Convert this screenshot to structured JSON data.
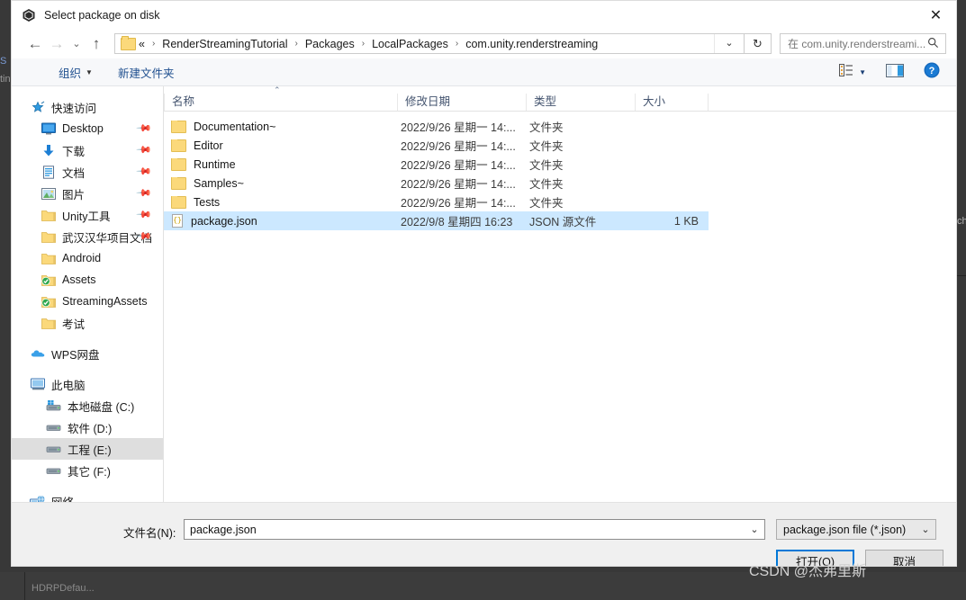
{
  "window": {
    "title": "Select package on disk",
    "app_icon": "unity-icon",
    "close_label": "✕"
  },
  "nav": {
    "back_icon": "←",
    "forward_icon": "→",
    "recent_icon": "⌄",
    "up_icon": "↑",
    "refresh_icon": "↻",
    "dropdown_icon": "⌄",
    "breadcrumbs": [
      "«",
      "RenderStreamingTutorial",
      "Packages",
      "LocalPackages",
      "com.unity.renderstreaming"
    ],
    "separator": "›"
  },
  "search": {
    "text": "在 com.unity.renderstreami...",
    "icon": "search-icon"
  },
  "command_bar": {
    "organize": "组织",
    "organize_chevron": "▼",
    "new_folder": "新建文件夹",
    "view_chevron": "▼",
    "help": "?"
  },
  "nav_pane": {
    "groups": [
      {
        "header": {
          "label": "快速访问",
          "icon": "star-pin-icon",
          "indent": 0,
          "pinned": false
        },
        "items": [
          {
            "label": "Desktop",
            "icon": "desktop-icon",
            "indent": 1,
            "pinned": true
          },
          {
            "label": "下载",
            "icon": "download-icon",
            "indent": 1,
            "pinned": true
          },
          {
            "label": "文档",
            "icon": "documents-icon",
            "indent": 1,
            "pinned": true
          },
          {
            "label": "图片",
            "icon": "pictures-icon",
            "indent": 1,
            "pinned": true
          },
          {
            "label": "Unity工具",
            "icon": "folder-icon",
            "indent": 1,
            "pinned": true
          },
          {
            "label": "武汉汉华项目文档",
            "icon": "folder-icon",
            "indent": 1,
            "pinned": true
          },
          {
            "label": "Android",
            "icon": "folder-icon",
            "indent": 1,
            "pinned": false
          },
          {
            "label": "Assets",
            "icon": "folder-sync-icon",
            "indent": 1,
            "pinned": false
          },
          {
            "label": "StreamingAssets",
            "icon": "folder-sync-icon",
            "indent": 1,
            "pinned": false
          },
          {
            "label": "考试",
            "icon": "folder-icon",
            "indent": 1,
            "pinned": false
          }
        ]
      },
      {
        "header": {
          "label": "WPS网盘",
          "icon": "cloud-icon",
          "indent": 0,
          "pinned": false
        },
        "items": []
      },
      {
        "header": {
          "label": "此电脑",
          "icon": "this-pc-icon",
          "indent": 0,
          "pinned": false
        },
        "items": [
          {
            "label": "本地磁盘 (C:)",
            "icon": "windows-drive-icon",
            "indent": 2,
            "pinned": false
          },
          {
            "label": "软件 (D:)",
            "icon": "drive-icon",
            "indent": 2,
            "pinned": false
          },
          {
            "label": "工程 (E:)",
            "icon": "drive-icon",
            "indent": 2,
            "pinned": false,
            "selected": true
          },
          {
            "label": "其它 (F:)",
            "icon": "drive-icon",
            "indent": 2,
            "pinned": false
          }
        ]
      },
      {
        "header": {
          "label": "网络",
          "icon": "network-icon",
          "indent": 0,
          "pinned": false
        },
        "items": []
      }
    ]
  },
  "file_list": {
    "columns": [
      {
        "label": "名称",
        "sorted": true,
        "sort_icon": "⌃"
      },
      {
        "label": "修改日期",
        "sorted": false
      },
      {
        "label": "类型",
        "sorted": false
      },
      {
        "label": "大小",
        "sorted": false
      }
    ],
    "rows": [
      {
        "name": "Documentation~",
        "icon": "folder-icon",
        "date": "2022/9/26 星期一 14:...",
        "type": "文件夹",
        "size": "",
        "selected": false
      },
      {
        "name": "Editor",
        "icon": "folder-icon",
        "date": "2022/9/26 星期一 14:...",
        "type": "文件夹",
        "size": "",
        "selected": false
      },
      {
        "name": "Runtime",
        "icon": "folder-icon",
        "date": "2022/9/26 星期一 14:...",
        "type": "文件夹",
        "size": "",
        "selected": false
      },
      {
        "name": "Samples~",
        "icon": "folder-icon",
        "date": "2022/9/26 星期一 14:...",
        "type": "文件夹",
        "size": "",
        "selected": false
      },
      {
        "name": "Tests",
        "icon": "folder-icon",
        "date": "2022/9/26 星期一 14:...",
        "type": "文件夹",
        "size": "",
        "selected": false
      },
      {
        "name": "package.json",
        "icon": "json-file-icon",
        "date": "2022/9/8 星期四 16:23",
        "type": "JSON 源文件",
        "size": "1 KB",
        "selected": true
      }
    ]
  },
  "footer": {
    "filename_label": "文件名(N):",
    "filename_value": "package.json",
    "filename_chevron": "⌄",
    "filter_value": "package.json file (*.json)",
    "filter_chevron": "⌄",
    "open_button": "打开(O)",
    "open_button_accel": "O",
    "cancel_button": "取消"
  },
  "backdrop": {
    "text_left_top": "S",
    "text_left_bottom": "tin",
    "text_right": "ch",
    "text_bottom": "HDRPDefau..."
  },
  "watermark": "CSDN @杰弗里斯",
  "colors": {
    "selection": "#cce8ff",
    "accent": "#0078d7",
    "link": "#1f4f8f",
    "folder": "#fbd97b",
    "backdrop": "#383838"
  }
}
